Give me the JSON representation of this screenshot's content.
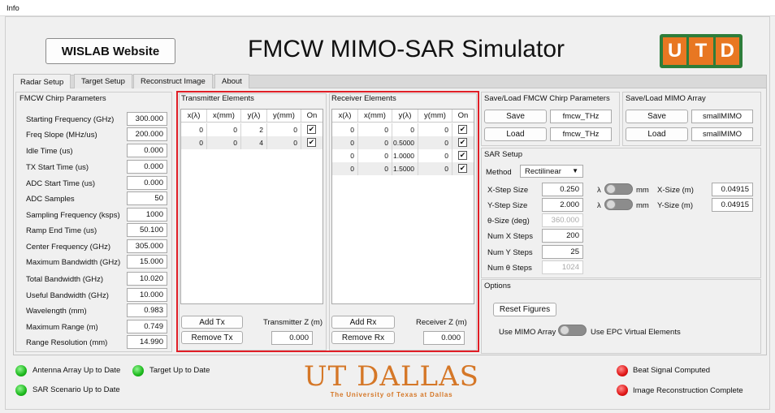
{
  "menu": {
    "info": "Info"
  },
  "header": {
    "website_button": "WISLAB Website",
    "title": "FMCW MIMO-SAR Simulator",
    "logo_letters": [
      "U",
      "T",
      "D"
    ]
  },
  "tabs": [
    "Radar Setup",
    "Target Setup",
    "Reconstruct Image",
    "About"
  ],
  "chirp": {
    "title": "FMCW Chirp Parameters",
    "params": [
      {
        "label": "Starting Frequency (GHz)",
        "value": "300.000"
      },
      {
        "label": "Freq Slope (MHz/us)",
        "value": "200.000"
      },
      {
        "label": "Idle Time (us)",
        "value": "0.000"
      },
      {
        "label": "TX Start Time (us)",
        "value": "0.000"
      },
      {
        "label": "ADC Start Time (us)",
        "value": "0.000"
      },
      {
        "label": "ADC Samples",
        "value": "50"
      },
      {
        "label": "Sampling Frequency (ksps)",
        "value": "1000"
      },
      {
        "label": "Ramp End Time (us)",
        "value": "50.100"
      },
      {
        "label": "Center Frequency (GHz)",
        "value": "305.000"
      },
      {
        "label": "Maximum Bandwidth (GHz)",
        "value": "15.000"
      },
      {
        "label": "Total Bandwidth (GHz)",
        "value": "10.020"
      },
      {
        "label": "Useful Bandwidth (GHz)",
        "value": "10.000"
      },
      {
        "label": "Wavelength (mm)",
        "value": "0.983"
      },
      {
        "label": "Maximum Range (m)",
        "value": "0.749"
      },
      {
        "label": "Range Resolution (mm)",
        "value": "14.990"
      }
    ]
  },
  "tx": {
    "title": "Transmitter Elements",
    "columns": [
      "x(λ)",
      "x(mm)",
      "y(λ)",
      "y(mm)",
      "On"
    ],
    "rows": [
      [
        "0",
        "0",
        "2",
        "0"
      ],
      [
        "0",
        "0",
        "4",
        "0"
      ]
    ],
    "add_label": "Add Tx",
    "remove_label": "Remove Tx",
    "z_label": "Transmitter Z (m)",
    "z_value": "0.000"
  },
  "rx": {
    "title": "Receiver Elements",
    "columns": [
      "x(λ)",
      "x(mm)",
      "y(λ)",
      "y(mm)",
      "On"
    ],
    "rows": [
      [
        "0",
        "0",
        "0",
        "0"
      ],
      [
        "0",
        "0",
        "0.5000",
        "0"
      ],
      [
        "0",
        "0",
        "1.0000",
        "0"
      ],
      [
        "0",
        "0",
        "1.5000",
        "0"
      ]
    ],
    "add_label": "Add Rx",
    "remove_label": "Remove Rx",
    "z_label": "Receiver Z (m)",
    "z_value": "0.000"
  },
  "check_mark": "✔",
  "save_load_chirp": {
    "title": "Save/Load FMCW Chirp Parameters",
    "save_label": "Save",
    "load_label": "Load",
    "save_name": "fmcw_THz",
    "load_name": "fmcw_THz"
  },
  "save_load_mimo": {
    "title": "Save/Load MIMO Array",
    "save_label": "Save",
    "load_label": "Load",
    "save_name": "smallMIMO",
    "load_name": "smallMIMO"
  },
  "sar": {
    "title": "SAR Setup",
    "method_label": "Method",
    "method_value": "Rectilinear",
    "x_step_label": "X-Step Size",
    "x_step_value": "0.250",
    "y_step_label": "Y-Step Size",
    "y_step_value": "2.000",
    "theta_size_label": "θ-Size (deg)",
    "theta_size_value": "360.000",
    "num_x_label": "Num X Steps",
    "num_x_value": "200",
    "num_y_label": "Num Y Steps",
    "num_y_value": "25",
    "num_theta_label": "Num θ Steps",
    "num_theta_value": "1024",
    "lambda_symbol": "λ",
    "mm_label": "mm",
    "x_size_label": "X-Size (m)",
    "x_size_value": "0.04915",
    "y_size_label": "Y-Size (m)",
    "y_size_value": "0.04915"
  },
  "options": {
    "title": "Options",
    "reset_label": "Reset Figures",
    "mimo_label": "Use MIMO Array",
    "epc_label": "Use EPC Virtual Elements"
  },
  "status": {
    "antenna": "Antenna Array Up to Date",
    "target": "Target Up to Date",
    "scenario": "SAR Scenario Up to Date",
    "beat": "Beat Signal Computed",
    "recon": "Image Reconstruction Complete"
  },
  "branding": {
    "main": "UT DALLAS",
    "sub": "The University of Texas at Dallas"
  },
  "colors": {
    "accent_red": "#e01e26",
    "status_green": "#1cb81c",
    "status_red": "#e01515",
    "utd_orange": "#e87722",
    "utd_green": "#2e7d3a"
  }
}
